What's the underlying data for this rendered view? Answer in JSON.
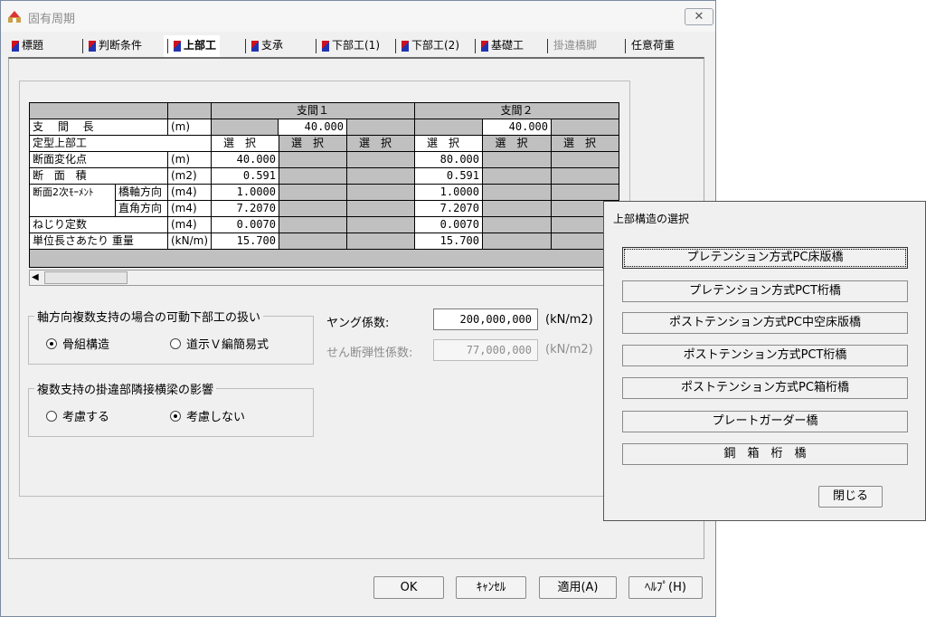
{
  "window": {
    "title": "固有周期",
    "close": "✕"
  },
  "tabs": [
    {
      "label": "標題",
      "flag": true
    },
    {
      "label": "判断条件",
      "flag": true
    },
    {
      "label": "上部工",
      "flag": true
    },
    {
      "label": "支承",
      "flag": true
    },
    {
      "label": "下部工(1)",
      "flag": true
    },
    {
      "label": "下部工(2)",
      "flag": true
    },
    {
      "label": "基礎工",
      "flag": true
    },
    {
      "label": "掛違橋脚",
      "flag": false
    },
    {
      "label": "任意荷重",
      "flag": false
    }
  ],
  "grid": {
    "span1": "支間１",
    "span2": "支間２",
    "rows": {
      "span_length": {
        "label": "支 間 長",
        "unit": "(m)",
        "v1": "40.000",
        "v2": "40.000"
      },
      "std_super": {
        "label": "定型上部工",
        "select": "選択"
      },
      "section_change": {
        "label": "断面変化点",
        "unit": "(m)",
        "v1": "40.000",
        "v2": "80.000"
      },
      "area": {
        "label": "断 面 積",
        "unit": "(m2)",
        "v1": "0.591",
        "v2": "0.591"
      },
      "moment_label": "断面2次ﾓｰﾒﾝﾄ",
      "moment_long": {
        "label": "橋軸方向",
        "unit": "(m4)",
        "v1": "1.0000",
        "v2": "1.0000"
      },
      "moment_perp": {
        "label": "直角方向",
        "unit": "(m4)",
        "v1": "7.2070",
        "v2": "7.2070"
      },
      "torsion": {
        "label": "ねじり定数",
        "unit": "(m4)",
        "v1": "0.0070",
        "v2": "0.0070"
      },
      "unit_weight": {
        "label": "単位長さあたり 重量",
        "unit": "(kN/m)",
        "v1": "15.700",
        "v2": "15.700"
      }
    }
  },
  "group_axial": {
    "title": "軸方向複数支持の場合の可動下部工の扱い",
    "opt1": "骨組構造",
    "opt2": "道示Ｖ編簡易式"
  },
  "group_beam": {
    "title": "複数支持の掛違部隣接横梁の影響",
    "opt1": "考慮する",
    "opt2": "考慮しない"
  },
  "young": {
    "label": "ヤング係数:",
    "value": "200,000,000",
    "unit": "(kN/m2)"
  },
  "shear": {
    "label": "せん断弾性係数:",
    "value": "77,000,000",
    "unit": "(kN/m2)"
  },
  "buttons": {
    "ok": "OK",
    "cancel": "ｷｬﾝｾﾙ",
    "apply": "適用(A)",
    "help": "ﾍﾙﾌﾟ(H)"
  },
  "popup": {
    "title": "上部構造の選択",
    "options": [
      "プレテンション方式PC床版橋",
      "プレテンション方式PCT桁橋",
      "ポストテンション方式PC中空床版橋",
      "ポストテンション方式PCT桁橋",
      "ポストテンション方式PC箱桁橋",
      "プレートガーダー橋",
      "鋼　箱　桁　橋"
    ],
    "close": "閉じる"
  }
}
